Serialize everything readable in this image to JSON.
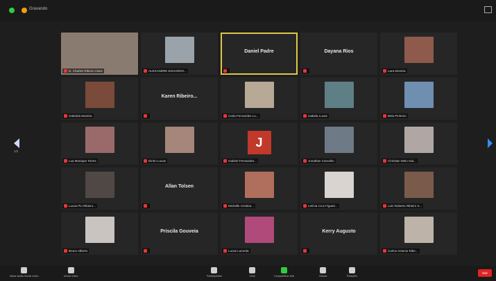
{
  "window": {
    "title": "Gravando"
  },
  "tiles": [
    {
      "name": "N. Charles Ribeiro Alves",
      "type": "video",
      "color": "#8a7b70",
      "wide": true
    },
    {
      "name": "ALEXANDRE EDUARDO...",
      "type": "video",
      "color": "#9aa3a9"
    },
    {
      "name": "",
      "type": "bigname",
      "display": "Daniel Padre",
      "active": true
    },
    {
      "name": "",
      "type": "bigname",
      "display": "Dayana Rios"
    },
    {
      "name": "Lara Moreira",
      "type": "video",
      "color": "#8d5a4c"
    },
    {
      "name": "Gabriela Moreira",
      "type": "video",
      "color": "#7a4a3a"
    },
    {
      "name": "",
      "type": "bigname",
      "display": "Karen Ribeiro..."
    },
    {
      "name": "Carla Fernandes Lo...",
      "type": "video",
      "color": "#b8a896"
    },
    {
      "name": "Isabela Lucas",
      "type": "video",
      "color": "#5f7f86"
    },
    {
      "name": "Bela Pinheiro",
      "type": "video",
      "color": "#6f8fb0"
    },
    {
      "name": "Lua Monique Torres",
      "type": "video",
      "color": "#9a6a6a"
    },
    {
      "name": "Dinho Lucas",
      "type": "video",
      "color": "#a6857a"
    },
    {
      "name": "Gabriel Fernandes...",
      "type": "initial",
      "initial": "J"
    },
    {
      "name": "Jonathan Carvalho",
      "type": "video",
      "color": "#6e7a86"
    },
    {
      "name": "Christian Melo Gal...",
      "type": "video",
      "color": "#b0a7a4"
    },
    {
      "name": "Lucas Pio Ribeiro...",
      "type": "video",
      "color": "#4f4844"
    },
    {
      "name": "",
      "type": "bigname",
      "display": "Allan Tolsen"
    },
    {
      "name": "Michelle Cristina...",
      "type": "video",
      "color": "#b06f5c"
    },
    {
      "name": "Letícia Cruz Figueir...",
      "type": "video",
      "color": "#d9d4d0"
    },
    {
      "name": "Luís Roberto Ribeiro S...",
      "type": "video",
      "color": "#7a5a4a"
    },
    {
      "name": "Bruno Alberto",
      "type": "video",
      "color": "#c9c4c0"
    },
    {
      "name": "",
      "type": "bigname",
      "display": "Priscila Gouveia"
    },
    {
      "name": "Lucas Lacerda",
      "type": "video",
      "color": "#b04a7a"
    },
    {
      "name": "",
      "type": "bigname",
      "display": "Kerry Augusto"
    },
    {
      "name": "Carlos Antonio Ribe...",
      "type": "video",
      "color": "#bdb3a8"
    }
  ],
  "pagination": {
    "left": "1/2",
    "right": "1/2"
  },
  "toolbar": {
    "items": [
      {
        "label": "Ativar áudio   Iniciar vídeo",
        "icon": "microphone-icon"
      },
      {
        "label": "Iniciar vídeo",
        "icon": "camera-icon"
      },
      {
        "label": "Participantes",
        "icon": "participants-icon"
      },
      {
        "label": "Chat",
        "icon": "chat-icon"
      },
      {
        "label": "Compartilhar tela",
        "icon": "share-screen-icon",
        "accent": "#2ecc40"
      },
      {
        "label": "Gravar",
        "icon": "record-icon"
      },
      {
        "label": "Reações",
        "icon": "reactions-icon"
      }
    ],
    "end_label": "Sair"
  }
}
